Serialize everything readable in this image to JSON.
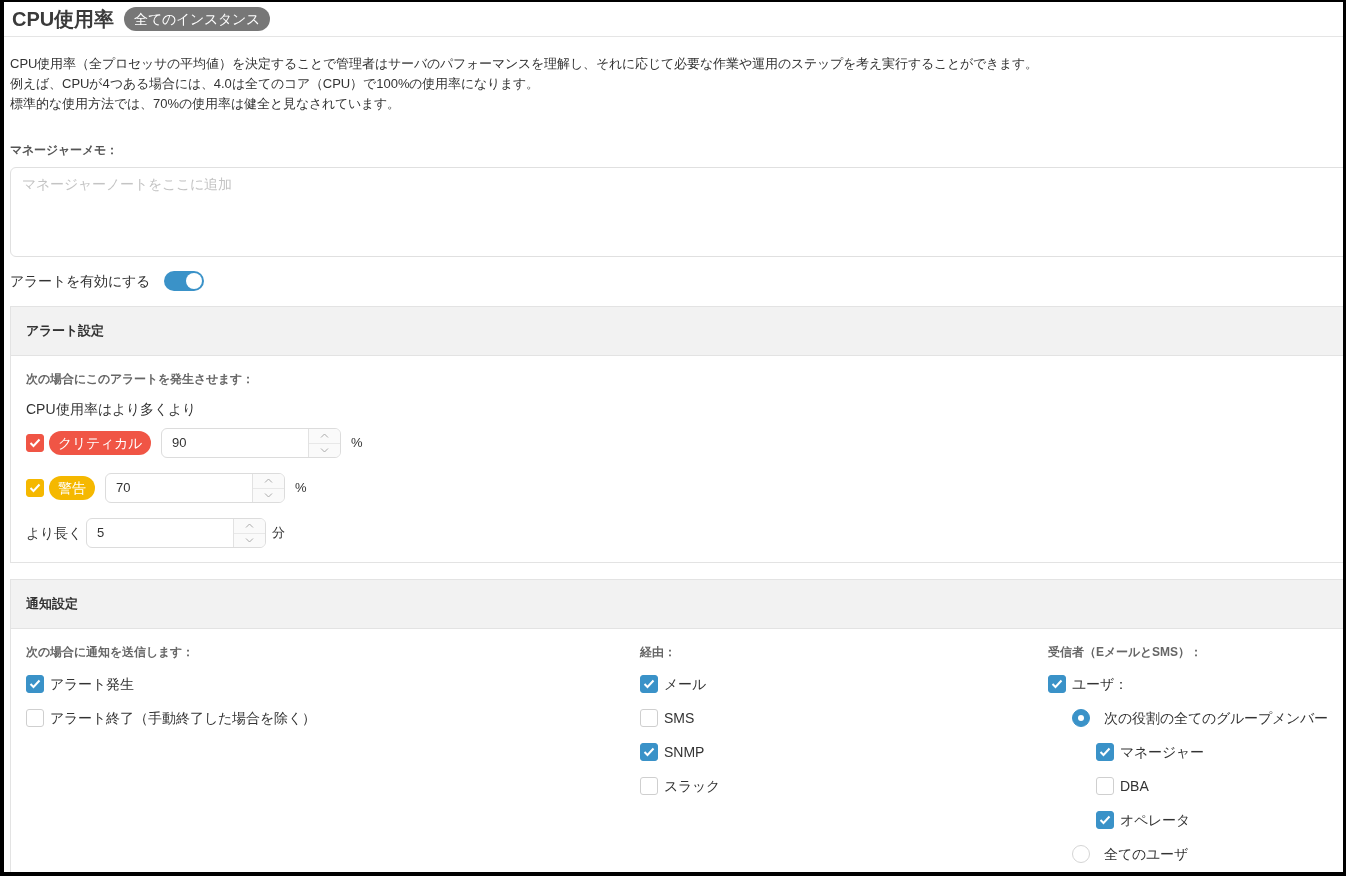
{
  "title": "CPU使用率",
  "scope_badge": "全てのインスタンス",
  "description": [
    "CPU使用率（全プロセッサの平均値）を決定することで管理者はサーバのパフォーマンスを理解し、それに応じて必要な作業や運用のステップを考え実行することができます。",
    "例えば、CPUが4つある場合には、4.0は全てのコア（CPU）で100%の使用率になります。",
    "標準的な使用方法では、70%の使用率は健全と見なされています。"
  ],
  "manager_memo": {
    "label": "マネージャーメモ：",
    "placeholder": "マネージャーノートをここに追加"
  },
  "alert_toggle": {
    "label": "アラートを有効にする",
    "on": true
  },
  "alert_settings": {
    "title": "アラート設定",
    "condition_label": "次の場合にこのアラートを発生させます：",
    "metric_label": "CPU使用率はより多くより",
    "thresholds": [
      {
        "label": "クリティカル",
        "color": "#f05545",
        "checked": true,
        "value": "90",
        "unit": "%"
      },
      {
        "label": "警告",
        "color": "#f5b800",
        "checked": true,
        "value": "70",
        "unit": "%"
      }
    ],
    "duration": {
      "label": "より長く",
      "value": "5",
      "unit": "分"
    }
  },
  "notification_settings": {
    "title": "通知設定",
    "send_when": {
      "label": "次の場合に通知を送信します：",
      "items": [
        {
          "label": "アラート発生",
          "checked": true
        },
        {
          "label": "アラート終了（手動終了した場合を除く）",
          "checked": false
        }
      ]
    },
    "via": {
      "label": "経由：",
      "items": [
        {
          "label": "メール",
          "checked": true
        },
        {
          "label": "SMS",
          "checked": false
        },
        {
          "label": "SNMP",
          "checked": true
        },
        {
          "label": "スラック",
          "checked": false
        }
      ]
    },
    "recipients": {
      "label": "受信者（EメールとSMS）：",
      "users": {
        "label": "ユーザ：",
        "checked": true
      },
      "options": [
        {
          "label": "次の役割の全てのグループメンバー",
          "selected": true,
          "children": [
            {
              "label": "マネージャー",
              "checked": true
            },
            {
              "label": "DBA",
              "checked": false
            },
            {
              "label": "オペレータ",
              "checked": true
            }
          ]
        },
        {
          "label": "全てのユーザ",
          "selected": false
        }
      ]
    }
  }
}
